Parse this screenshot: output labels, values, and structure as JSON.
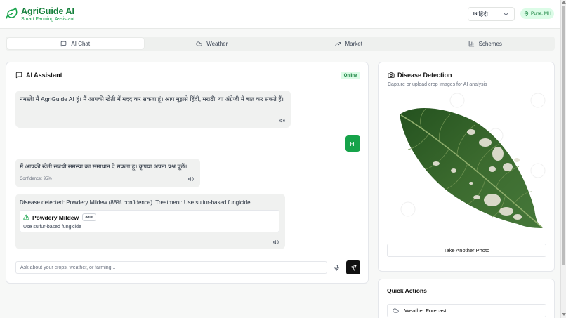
{
  "header": {
    "title": "AgriGuide AI",
    "subtitle": "Smart Farming Assistant",
    "language": {
      "flag": "IN",
      "selected": "हिंदी"
    },
    "location": "Pune, MH"
  },
  "tabs": [
    {
      "label": "AI Chat",
      "icon": "message-icon",
      "active": true
    },
    {
      "label": "Weather",
      "icon": "cloud-icon",
      "active": false
    },
    {
      "label": "Market",
      "icon": "trend-up-icon",
      "active": false
    },
    {
      "label": "Schemes",
      "icon": "bar-chart-icon",
      "active": false
    }
  ],
  "chat": {
    "title": "AI Assistant",
    "status": "Online",
    "messages": [
      {
        "role": "assistant",
        "text": "नमस्ते! मैं AgriGuide AI हूं। मैं आपकी खेती में मदद कर सकता हूं। आप मुझसे हिंदी, मराठी, या अंग्रेजी में बात कर सकते हैं।"
      },
      {
        "role": "user",
        "text": "Hi"
      },
      {
        "role": "assistant",
        "text": "मैं आपकी खेती संबंधी समस्या का समाधान दे सकता हूं। कृपया अपना प्रश्न पूछें।",
        "confidence": "Confidence: 95%"
      },
      {
        "role": "assistant",
        "text": "Disease detected: Powdery Mildew (88% confidence). Treatment: Use sulfur-based fungicide",
        "disease": {
          "name": "Powdery Mildew",
          "confidence": "88%",
          "treatment": "Use sulfur-based fungicide"
        }
      }
    ],
    "input_placeholder": "Ask about your crops, weather, or farming..."
  },
  "detection": {
    "title": "Disease Detection",
    "subtitle": "Capture or upload crop images for AI analysis",
    "button_label": "Take Another Photo"
  },
  "quick_actions": {
    "title": "Quick Actions",
    "items": [
      {
        "label": "Weather Forecast",
        "icon": "cloud-icon"
      }
    ]
  },
  "colors": {
    "brand_green": "#16a34a",
    "brand_dark_green": "#16803c",
    "badge_bg": "#dcfce7",
    "send_button": "#111111"
  }
}
